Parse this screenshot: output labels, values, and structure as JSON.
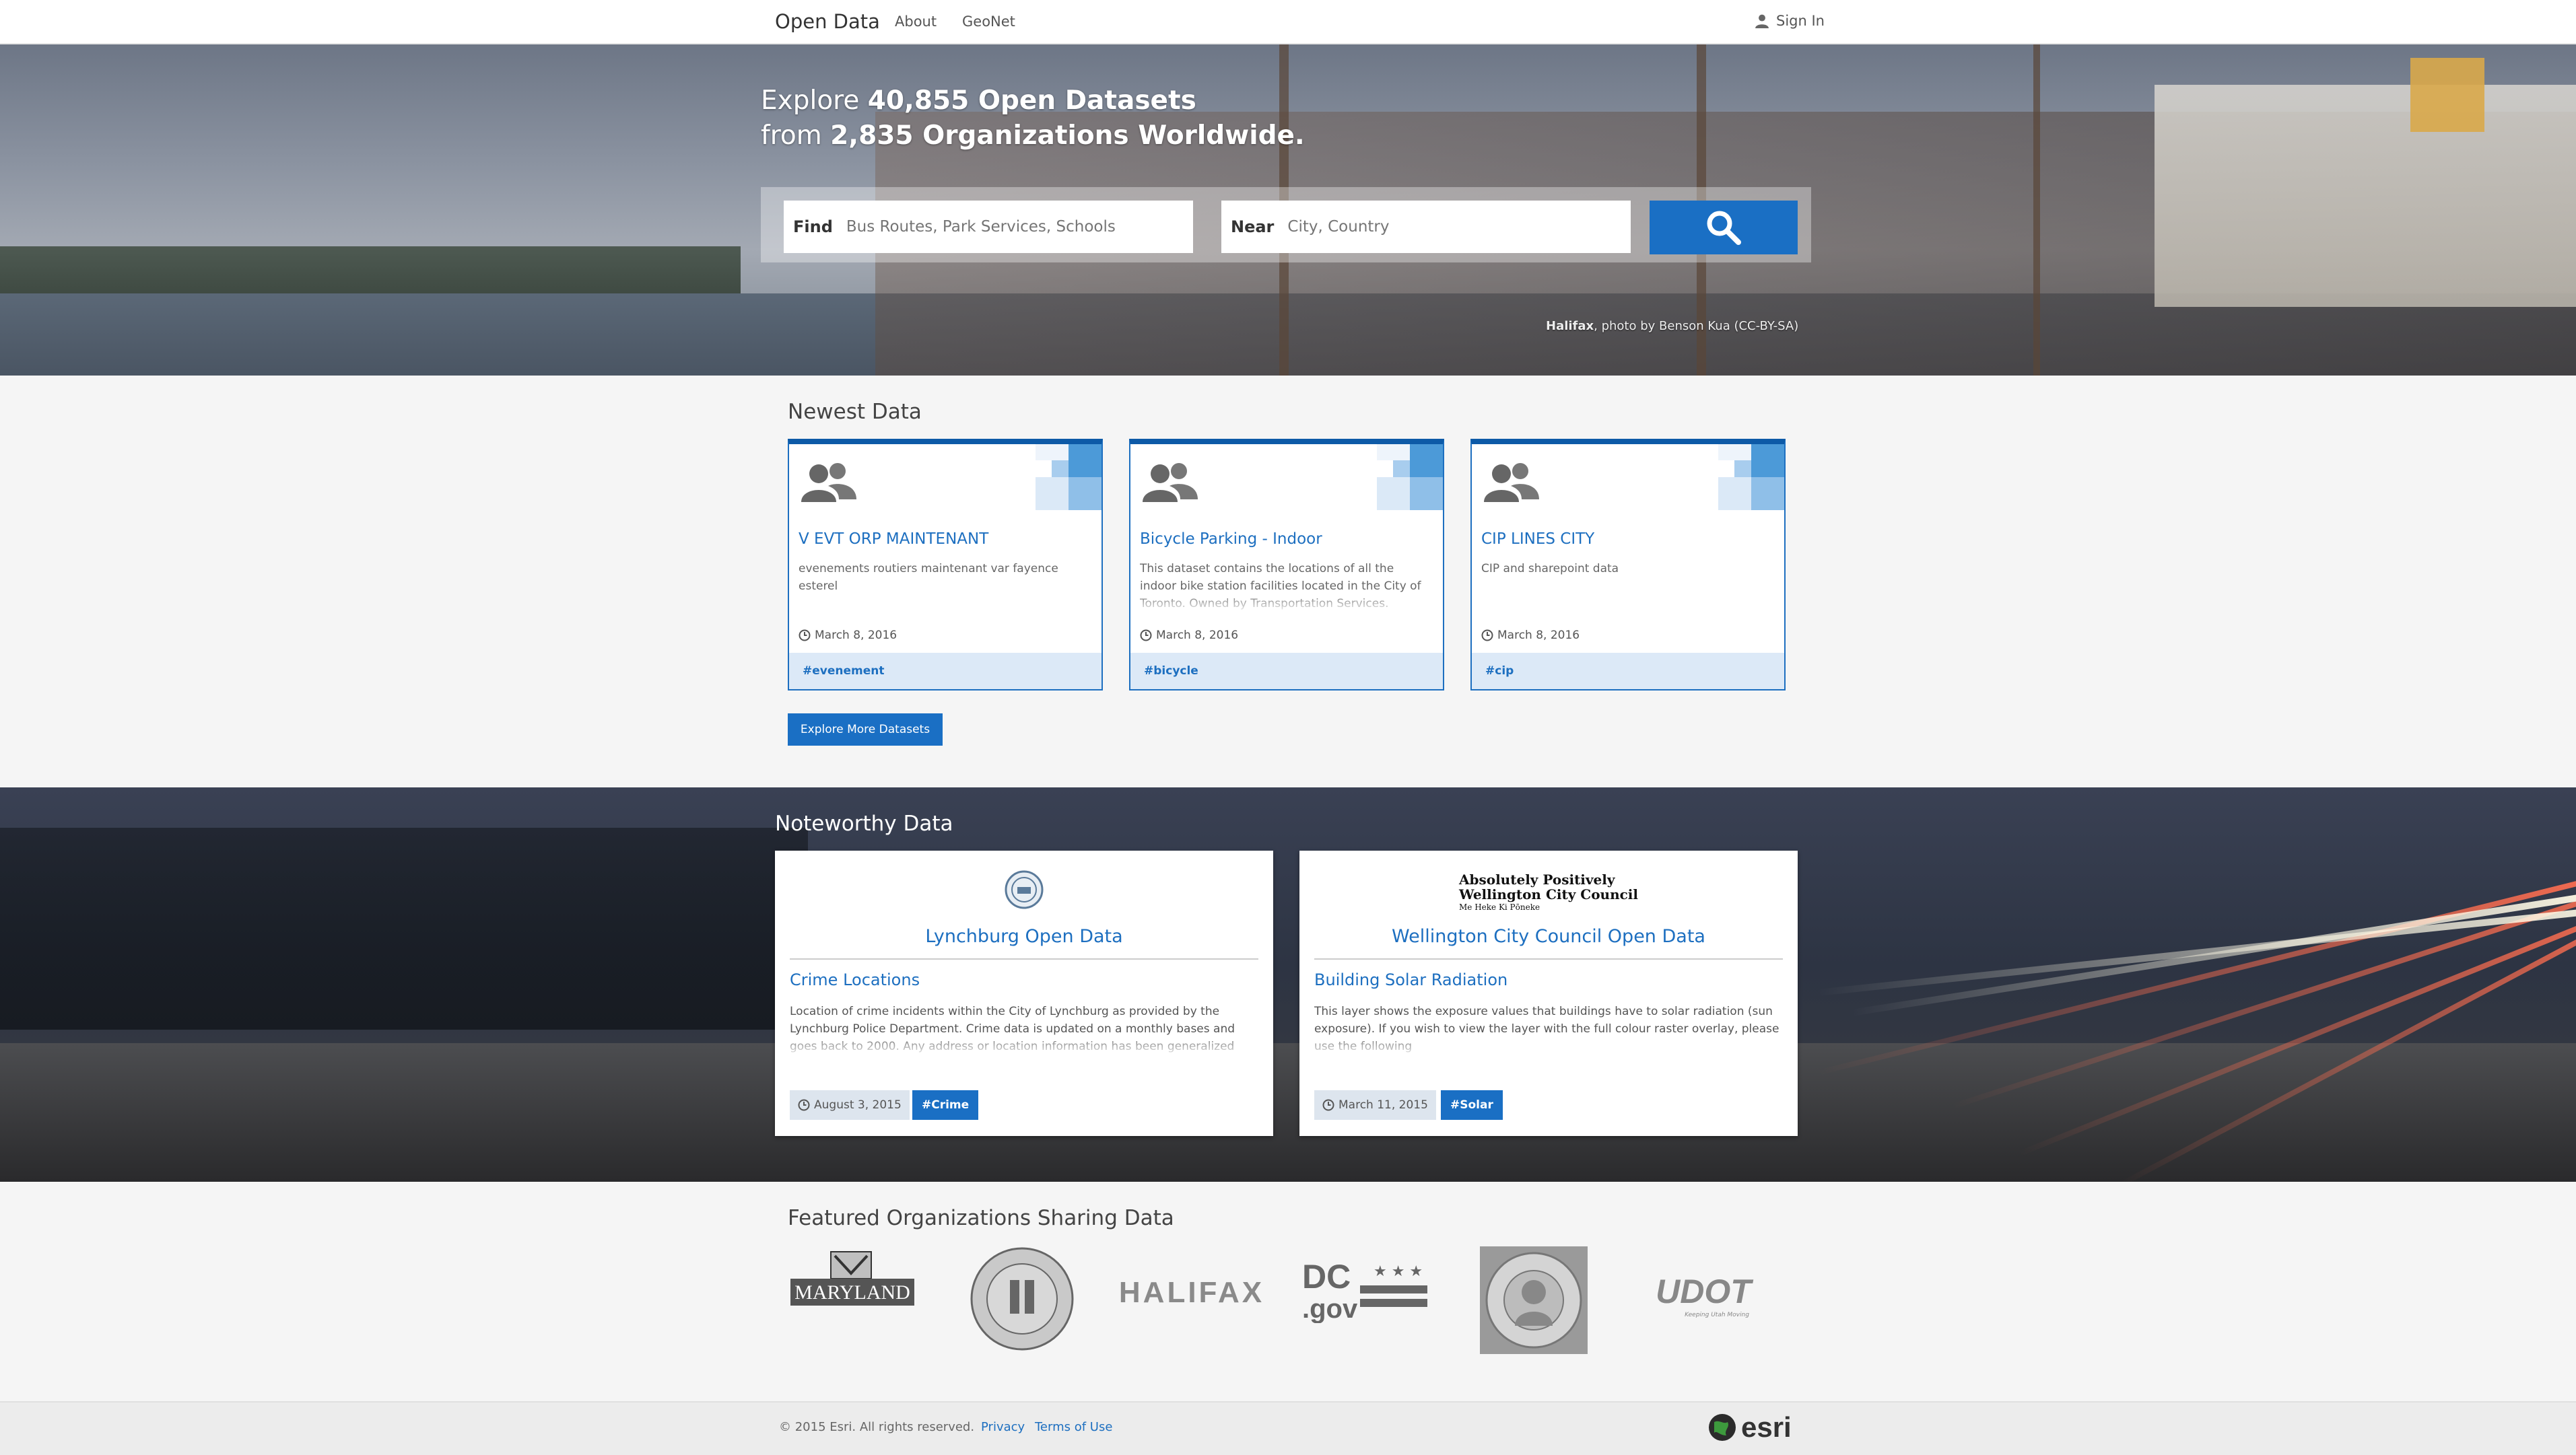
{
  "nav": {
    "brand": "Open Data",
    "links": [
      "About",
      "GeoNet"
    ],
    "signin": "Sign In"
  },
  "hero": {
    "line1_pre": "Explore ",
    "line1_bold": "40,855 Open Datasets",
    "line2_pre": "from ",
    "line2_bold": "2,835 Organizations Worldwide.",
    "find_label": "Find",
    "find_placeholder": "Bus Routes, Park Services, Schools",
    "near_label": "Near",
    "near_placeholder": "City, Country",
    "credit_place": "Halifax",
    "credit_rest": ", photo by Benson Kua (CC-BY-SA)"
  },
  "newest": {
    "title": "Newest Data",
    "cards": [
      {
        "title": "V EVT ORP MAINTENANT",
        "desc": "evenements routiers maintenant var fayence esterel",
        "date": "March 8, 2016",
        "tag": "#evenement"
      },
      {
        "title": "Bicycle Parking - Indoor",
        "desc": "This dataset contains the locations of all the indoor bike station facilities located in the City of Toronto.  Owned by Transportation Services.",
        "date": "March 8, 2016",
        "tag": "#bicycle"
      },
      {
        "title": "CIP LINES CITY",
        "desc": "CIP and sharepoint data",
        "date": "March 8, 2016",
        "tag": "#cip"
      }
    ],
    "explore_button": "Explore More Datasets"
  },
  "noteworthy": {
    "title": "Noteworthy Data",
    "cards": [
      {
        "org": "Lynchburg Open Data",
        "title": "Crime Locations",
        "desc": "Location of crime incidents within the City of Lynchburg as provided by the Lynchburg Police Department. Crime data is updated on a monthly bases and goes back to 2000. Any address or location information has been generalized",
        "date": "August 3, 2015",
        "tag": "#Crime"
      },
      {
        "org": "Wellington City Council Open Data",
        "title": "Building Solar Radiation",
        "desc": "This layer shows the exposure values that buildings have to solar radiation (sun exposure). If you wish to view the layer with the full colour raster overlay, please use the following",
        "date": "March 11, 2015",
        "tag": "#Solar"
      }
    ],
    "wellington_logo": {
      "line1": "Absolutely Positively",
      "line2": "Wellington City Council",
      "line3": "Me Heke Ki Pōneke"
    }
  },
  "featured": {
    "title": "Featured Organizations Sharing Data",
    "logos": [
      "Maryland",
      "Commonwealth of Kentucky seal",
      "Halifax",
      "DC.gov",
      "Seal of the State of Washington",
      "UDOT"
    ],
    "logo_text": {
      "maryland": "MARYLAND",
      "halifax": "HALIFAX",
      "dc_top": "DC",
      "dc_bottom": ".gov",
      "udot": "UDOT",
      "udot_tag": "Keeping Utah Moving"
    }
  },
  "footer": {
    "copyright": "© 2015 Esri. All rights reserved.",
    "privacy": "Privacy",
    "terms": "Terms of Use",
    "esri": "esri"
  },
  "colors": {
    "accent": "#1a6fc4",
    "tag_bg": "#dce9f7",
    "card_border": "#0d5aa7"
  }
}
